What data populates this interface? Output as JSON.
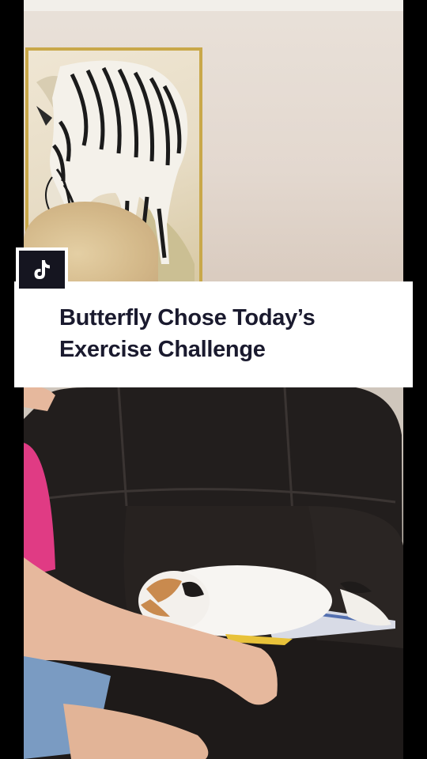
{
  "overlay": {
    "caption_line1": "Butterfly Chose Today’s",
    "caption_line2": "Exercise Challenge"
  },
  "logo": {
    "icon": "tiktok-logo-icon",
    "background": "#151520",
    "glyph": "#ffffff"
  },
  "colors": {
    "frame_gold": "#c9a84a",
    "shirt_pink": "#e03b84",
    "chair_leather": "#201c1b"
  }
}
